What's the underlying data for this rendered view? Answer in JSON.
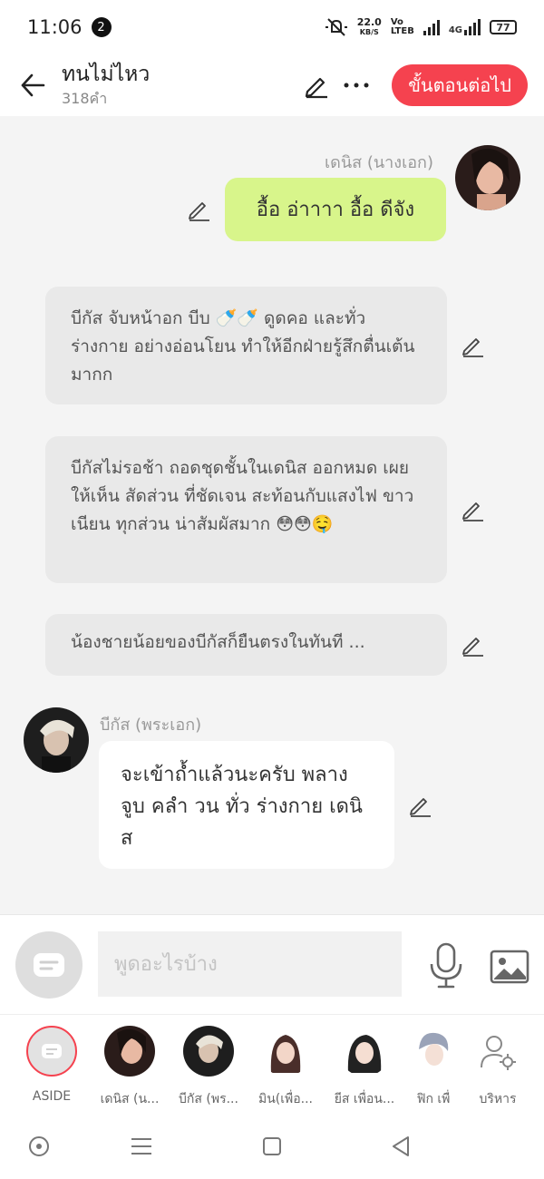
{
  "status_bar": {
    "time": "11:06",
    "notif_count": "2",
    "speed_value": "22.0",
    "speed_unit": "KB/S",
    "volte_top": "Vo",
    "volte_bottom": "LTEB",
    "net_type": "4G",
    "battery": "77"
  },
  "header": {
    "title": "ทนไม่ไหว",
    "subtitle": "318คำ",
    "next_label": "ขั้นตอนต่อไป"
  },
  "messages": [
    {
      "type": "right",
      "sender": "เดนิส (นางเอก)",
      "text": "อื้อ อ่าาาา อื้อ ดีจัง"
    },
    {
      "type": "narration",
      "text": "บีกัส จับหน้าอก บีบ 🍼🍼 ดูดคอ และทั่วร่างกาย อย่างอ่อนโยน ทำให้อีกฝ่ายรู้สึกตื่นเต้นมากก"
    },
    {
      "type": "narration",
      "text": "บีกัสไม่รอช้า ถอดชุดชั้นในเดนิส ออกหมด เผยให้เห็น สัดส่วน ที่ชัดเจน สะท้อนกับแสงไฟ ขาวเนียน ทุกส่วน น่าสัมผัสมาก 😳😳🤤"
    },
    {
      "type": "narration",
      "text": "น้องชายน้อยของบีกัสก็ยืนตรงในทันที ..."
    },
    {
      "type": "left",
      "sender": "บีกัส (พระเอก)",
      "text": "จะเข้าถ้ำแล้วนะครับ พลาง จูบ คลำ วน ทั่ว ร่างกาย เดนิส"
    }
  ],
  "input": {
    "placeholder": "พูดอะไรบ้าง"
  },
  "characters": [
    {
      "label": "ASIDE"
    },
    {
      "label": "เดนิส (น..."
    },
    {
      "label": "บีกัส (พร..."
    },
    {
      "label": "มิน(เพื่อ..."
    },
    {
      "label": "ยีส เพื่อน..."
    },
    {
      "label": "ฟิก เพื่"
    },
    {
      "label": "บริหาร"
    }
  ],
  "colors": {
    "accent": "#f5424f",
    "user_bubble": "#d8f58b",
    "narration_bubble": "#e9e9e9"
  }
}
